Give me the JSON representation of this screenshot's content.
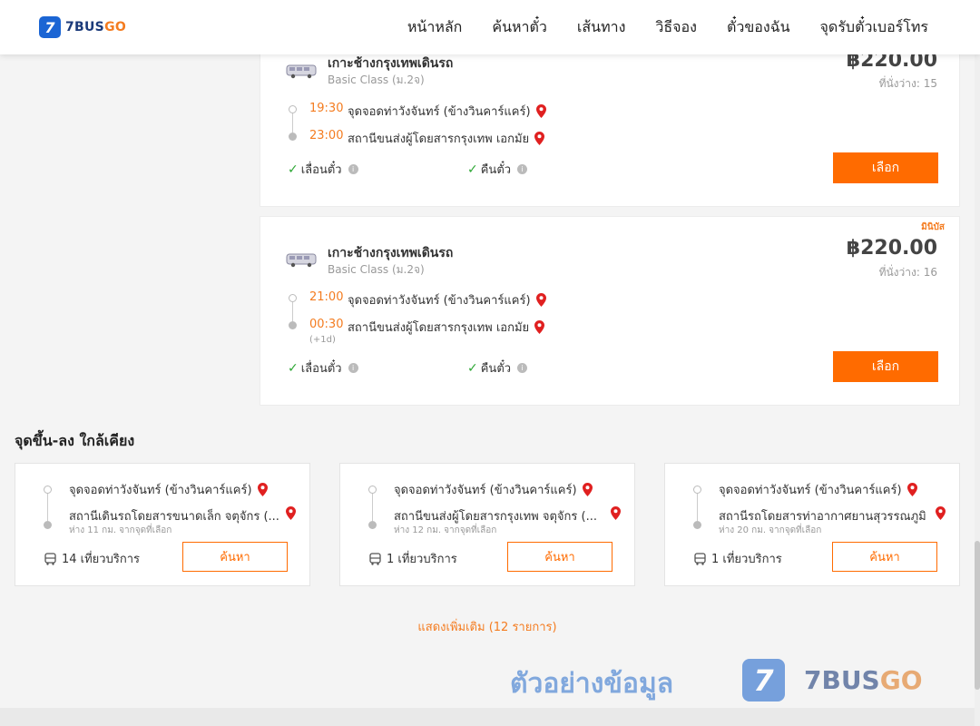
{
  "header": {
    "logo_num": "7",
    "logo_a": "7BUS",
    "logo_b": "GO",
    "nav": [
      "หน้าหลัก",
      "ค้นหาตั๋ว",
      "เส้นทาง",
      "วิธีจอง",
      "ตั๋วของฉัน",
      "จุดรับตั๋วเบอร์โทร"
    ]
  },
  "trips": [
    {
      "operator": "เกาะช้างกรุงเทพเดินรถ",
      "class": "Basic Class (ม.2จ)",
      "price": "฿220.00",
      "seats": "ที่นั่งว่าง: 15",
      "badge": "",
      "dep_time": "19:30",
      "dep_stop": "จุดจอดท่าวังจันทร์ (ข้างวินคาร์แคร์)",
      "arr_time": "23:00",
      "arr_stop": "สถานีขนส่งผู้โดยสารกรุงเทพ เอกมัย",
      "next_day": "",
      "feature_1": "เลื่อนตั๋ว",
      "feature_2": "คืนตั๋ว",
      "button": "เลือก"
    },
    {
      "operator": "เกาะช้างกรุงเทพเดินรถ",
      "class": "Basic Class (ม.2จ)",
      "price": "฿220.00",
      "seats": "ที่นั่งว่าง: 16",
      "badge": "มินิบัส",
      "dep_time": "21:00",
      "dep_stop": "จุดจอดท่าวังจันทร์ (ข้างวินคาร์แคร์)",
      "arr_time": "00:30",
      "arr_stop": "สถานีขนส่งผู้โดยสารกรุงเทพ เอกมัย",
      "next_day": "(+1d)",
      "feature_1": "เลื่อนตั๋ว",
      "feature_2": "คืนตั๋ว",
      "button": "เลือก"
    }
  ],
  "nearby": {
    "title": "จุดขึ้น-ลง ใกล้เคียง",
    "cards": [
      {
        "from": "จุดจอดท่าวังจันทร์ (ข้างวินคาร์แคร์)",
        "to": "สถานีเดินรถโดยสารขนาดเล็ก จตุจักร (...",
        "distance": "ห่าง 11 กม. จากจุดที่เลือก",
        "trips": "14 เที่ยวบริการ",
        "button": "ค้นหา"
      },
      {
        "from": "จุดจอดท่าวังจันทร์ (ข้างวินคาร์แคร์)",
        "to": "สถานีขนส่งผู้โดยสารกรุงเทพ จตุจักร (...",
        "distance": "ห่าง 12 กม. จากจุดที่เลือก",
        "trips": "1 เที่ยวบริการ",
        "button": "ค้นหา"
      },
      {
        "from": "จุดจอดท่าวังจันทร์ (ข้างวินคาร์แคร์)",
        "to": "สถานีรถโดยสารท่าอากาศยานสุวรรณภูมิ",
        "distance": "ห่าง 20 กม. จากจุดที่เลือก",
        "trips": "1 เที่ยวบริการ",
        "button": "ค้นหา"
      }
    ]
  },
  "show_more": "แสดงเพิ่มเติม (12 รายการ)",
  "watermark": {
    "text": "ตัวอย่างข้อมูล",
    "badge": "7",
    "logo_a": "7BUS",
    "logo_b": "GO"
  },
  "colors": {
    "accent": "#ff6b00",
    "brand_blue": "#1b65d4",
    "time_orange": "#f47c20",
    "check_green": "#2ea836",
    "pin_red": "#e02020"
  }
}
